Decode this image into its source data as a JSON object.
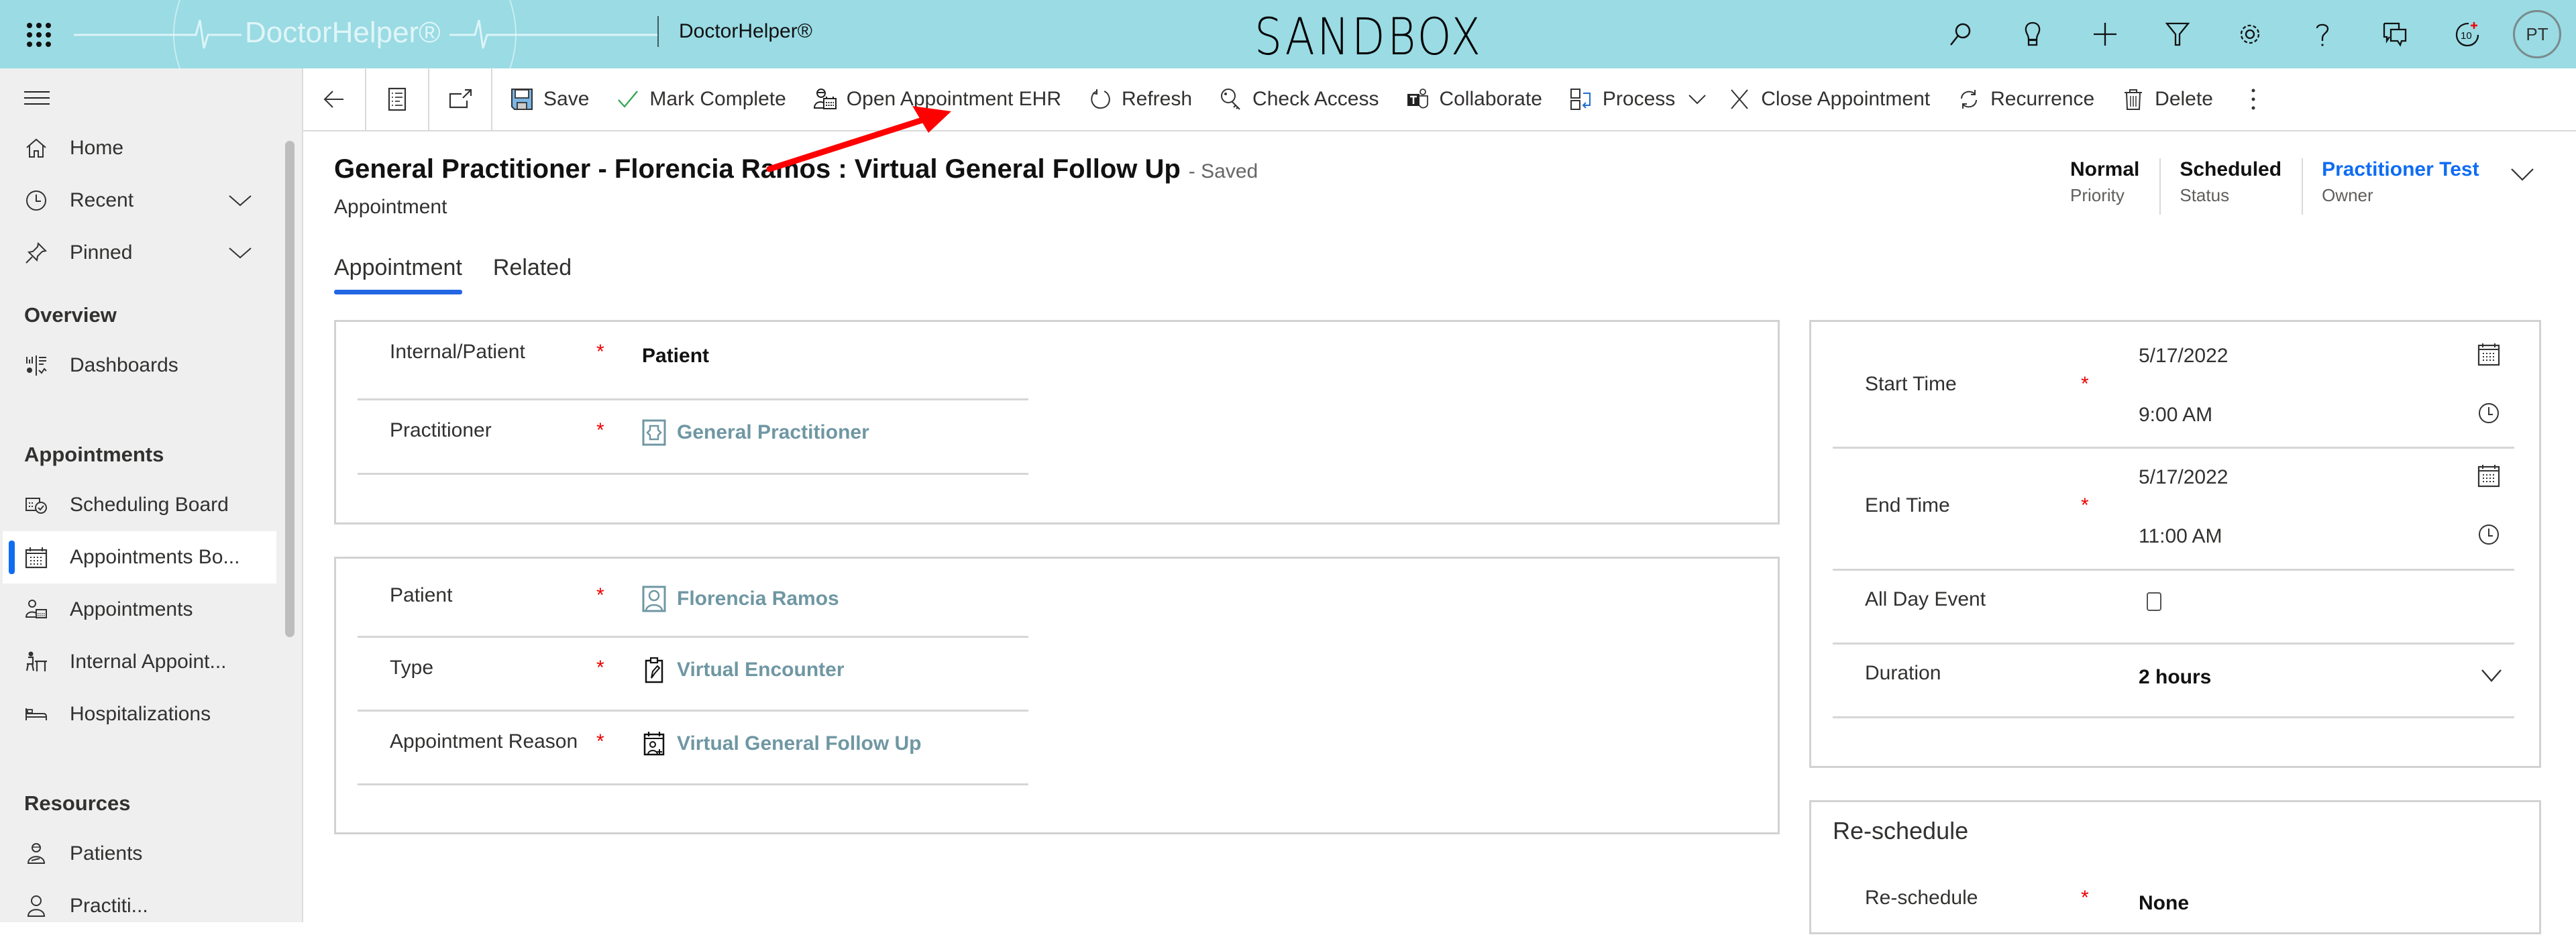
{
  "header": {
    "logo_text": "DoctorHelper®",
    "app_name": "DoctorHelper®",
    "environment": "SANDBOX",
    "icons": [
      "search-icon",
      "lightbulb-icon",
      "plus-icon",
      "filter-icon",
      "gear-icon",
      "help-icon",
      "chat-icon",
      "notification-icon"
    ],
    "notification_badge": "10",
    "avatar_initials": "PT"
  },
  "sidebar": {
    "top_items": [
      {
        "label": "Home",
        "icon": "home-icon"
      },
      {
        "label": "Recent",
        "icon": "clock-icon",
        "expandable": true
      },
      {
        "label": "Pinned",
        "icon": "pin-icon",
        "expandable": true
      }
    ],
    "sections": [
      {
        "title": "Overview",
        "items": [
          {
            "label": "Dashboards",
            "icon": "dashboard-icon"
          }
        ]
      },
      {
        "title": "Appointments",
        "items": [
          {
            "label": "Scheduling Board",
            "icon": "scheduling-board-icon"
          },
          {
            "label": "Appointments Bo...",
            "icon": "calendar-icon",
            "active": true
          },
          {
            "label": "Appointments",
            "icon": "person-calendar-icon"
          },
          {
            "label": "Internal Appoint...",
            "icon": "person-desk-icon"
          },
          {
            "label": "Hospitalizations",
            "icon": "bed-icon"
          }
        ]
      },
      {
        "title": "Resources",
        "items": [
          {
            "label": "Patients",
            "icon": "patient-icon"
          },
          {
            "label": "Practiti...",
            "icon": "practitioner-icon"
          }
        ]
      }
    ],
    "active_color": "#0f6cf3"
  },
  "toolbar": {
    "nav_buttons": [
      "back-icon",
      "record-list-icon",
      "open-new-window-icon"
    ],
    "buttons": [
      {
        "label": "Save",
        "icon": "save-icon"
      },
      {
        "label": "Mark Complete",
        "icon": "checkmark-icon"
      },
      {
        "label": "Open Appointment EHR",
        "icon": "ehr-icon"
      },
      {
        "label": "Refresh",
        "icon": "refresh-icon"
      },
      {
        "label": "Check Access",
        "icon": "key-icon"
      },
      {
        "label": "Collaborate",
        "icon": "teams-icon"
      },
      {
        "label": "Process",
        "icon": "process-icon",
        "has_dropdown": true
      },
      {
        "label": "Close Appointment",
        "icon": "close-icon"
      },
      {
        "label": "Recurrence",
        "icon": "recurrence-icon"
      },
      {
        "label": "Delete",
        "icon": "trash-icon"
      }
    ],
    "more": "more-icon"
  },
  "record": {
    "title": "General Practitioner - Florencia Ramos : Virtual General Follow Up",
    "save_status": "- Saved",
    "entity": "Appointment",
    "header_fields": [
      {
        "value": "Normal",
        "label": "Priority"
      },
      {
        "value": "Scheduled",
        "label": "Status"
      },
      {
        "value": "Practitioner Test",
        "label": "Owner",
        "link": true
      }
    ]
  },
  "tabs": [
    {
      "label": "Appointment",
      "active": true
    },
    {
      "label": "Related",
      "active": false
    }
  ],
  "form": {
    "card1": [
      {
        "label": "Internal/Patient",
        "required": true,
        "value": "Patient",
        "type": "text"
      },
      {
        "label": "Practitioner",
        "required": true,
        "value": "General Practitioner",
        "type": "lookup",
        "icon": "practitioner-lookup-icon"
      }
    ],
    "card2": [
      {
        "label": "Patient",
        "required": true,
        "value": "Florencia Ramos",
        "type": "lookup",
        "icon": "patient-lookup-icon"
      },
      {
        "label": "Type",
        "required": true,
        "value": "Virtual Encounter",
        "type": "lookup",
        "icon": "clipboard-icon"
      },
      {
        "label": "Appointment Reason",
        "required": true,
        "value": "Virtual General Follow Up",
        "type": "lookup",
        "icon": "calendar-person-icon"
      }
    ],
    "schedule": {
      "start_time": {
        "label": "Start Time",
        "required": true,
        "date": "5/17/2022",
        "time": "9:00 AM"
      },
      "end_time": {
        "label": "End Time",
        "required": true,
        "date": "5/17/2022",
        "time": "11:00 AM"
      },
      "all_day_event": {
        "label": "All Day Event",
        "checked": false
      },
      "duration": {
        "label": "Duration",
        "value": "2 hours"
      }
    },
    "reschedule": {
      "section_title": "Re-schedule",
      "field": {
        "label": "Re-schedule",
        "required": true,
        "value": "None"
      }
    },
    "required_marker": "*"
  },
  "annotation": {
    "type": "arrow",
    "color": "#ff0000",
    "target": "Open Appointment EHR"
  }
}
